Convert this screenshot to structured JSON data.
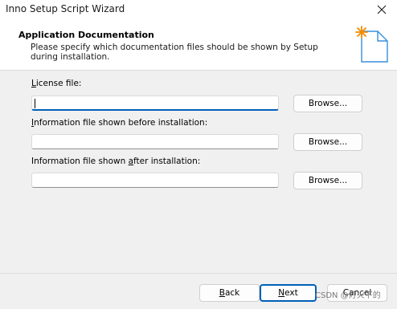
{
  "window": {
    "title": "Inno Setup Script Wizard"
  },
  "header": {
    "title": "Application Documentation",
    "subtitle": "Please specify which documentation files should be shown by Setup during installation."
  },
  "fields": [
    {
      "label_pre": "",
      "label_acc": "L",
      "label_post": "icense file:",
      "value": "",
      "browse_label": "Browse..."
    },
    {
      "label_pre": "",
      "label_acc": "I",
      "label_post": "nformation file shown before installation:",
      "value": "",
      "browse_label": "Browse..."
    },
    {
      "label_pre": "Information file shown ",
      "label_acc": "a",
      "label_post": "fter installation:",
      "value": "",
      "browse_label": "Browse..."
    }
  ],
  "footer": {
    "back_acc": "B",
    "back_rest": "ack",
    "next_acc": "N",
    "next_rest": "ext",
    "cancel_label": "Cancel"
  },
  "watermark": "CSDN @灯火下的",
  "colors": {
    "accent": "#005fb8",
    "icon_star": "#f08c00"
  },
  "icons": [
    "close-icon",
    "document-icon"
  ]
}
